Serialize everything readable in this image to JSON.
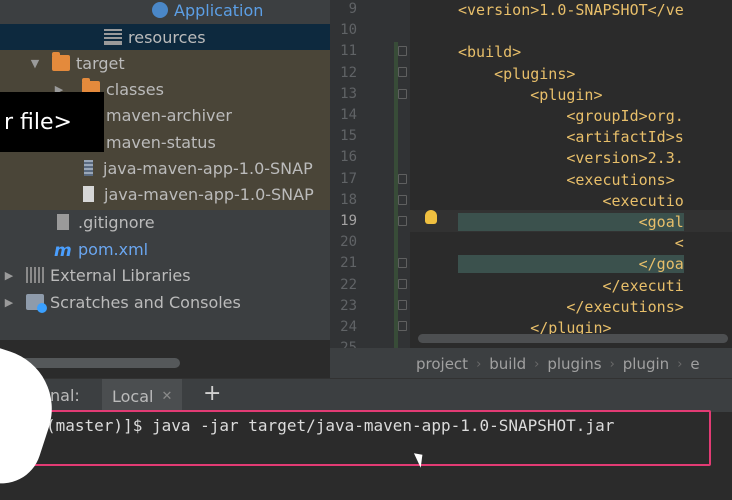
{
  "project_tree": {
    "items": [
      {
        "label": "Application"
      },
      {
        "label": "resources"
      },
      {
        "label": "target"
      },
      {
        "label": "classes"
      },
      {
        "label": "maven-archiver"
      },
      {
        "label": "maven-status"
      },
      {
        "label": "java-maven-app-1.0-SNAP"
      },
      {
        "label": "java-maven-app-1.0-SNAP"
      },
      {
        "label": ".gitignore"
      },
      {
        "label": "pom.xml"
      },
      {
        "label": "External Libraries"
      },
      {
        "label": "Scratches and Consoles"
      }
    ]
  },
  "overlay": {
    "text": "r file>"
  },
  "editor": {
    "line_numbers": [
      "9",
      "10",
      "11",
      "12",
      "13",
      "14",
      "15",
      "16",
      "17",
      "18",
      "19",
      "20",
      "21",
      "22",
      "23",
      "24",
      "25"
    ],
    "lines": [
      "<version>1.0-SNAPSHOT</ve",
      "",
      "<build>",
      "    <plugins>",
      "        <plugin>",
      "            <groupId>org.",
      "            <artifactId>s",
      "            <version>2.3.",
      "            <executions> ",
      "                <executio",
      "                    <goal",
      "                        <",
      "                    </goa",
      "                </executi",
      "            </executions>",
      "        </plugin>",
      ""
    ],
    "current_line": "19"
  },
  "breadcrumb": [
    "project",
    "build",
    "plugins",
    "plugin",
    "e"
  ],
  "terminal": {
    "label": "minal:",
    "tab_label": "Local",
    "command": "(master)]$ java -jar target/java-maven-app-1.0-SNAPSHOT.jar"
  },
  "colors": {
    "tag": "#e8bf6a",
    "highlight_box": "#e23b74",
    "accent_blue": "#4a9fff"
  }
}
